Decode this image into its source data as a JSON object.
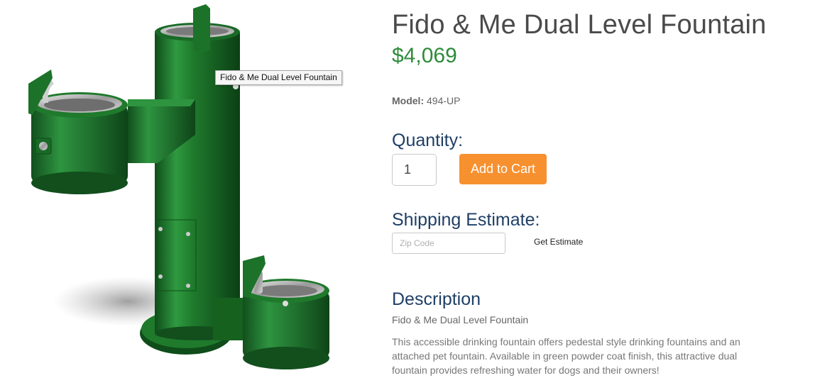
{
  "product": {
    "image_tooltip": "Fido & Me Dual Level Fountain",
    "title": "Fido & Me Dual Level Fountain",
    "price": "$4,069",
    "model_label": "Model:",
    "model_value": "494-UP"
  },
  "quantity": {
    "label": "Quantity:",
    "value": "1"
  },
  "cart": {
    "add_label": "Add to Cart",
    "button_color": "#f7902f"
  },
  "shipping": {
    "label": "Shipping Estimate:",
    "zip_placeholder": "Zip Code",
    "estimate_label": "Get Estimate"
  },
  "description": {
    "label": "Description",
    "subtitle": "Fido & Me Dual Level Fountain",
    "text": "This accessible drinking fountain offers pedestal style drinking fountains and an attached pet fountain. Available in green powder coat finish, this attractive dual fountain provides refreshing water for dogs and their owners!"
  },
  "colors": {
    "price": "#2e8b3a",
    "heading": "#1f3f66",
    "product_green": "#1f7a2c"
  }
}
